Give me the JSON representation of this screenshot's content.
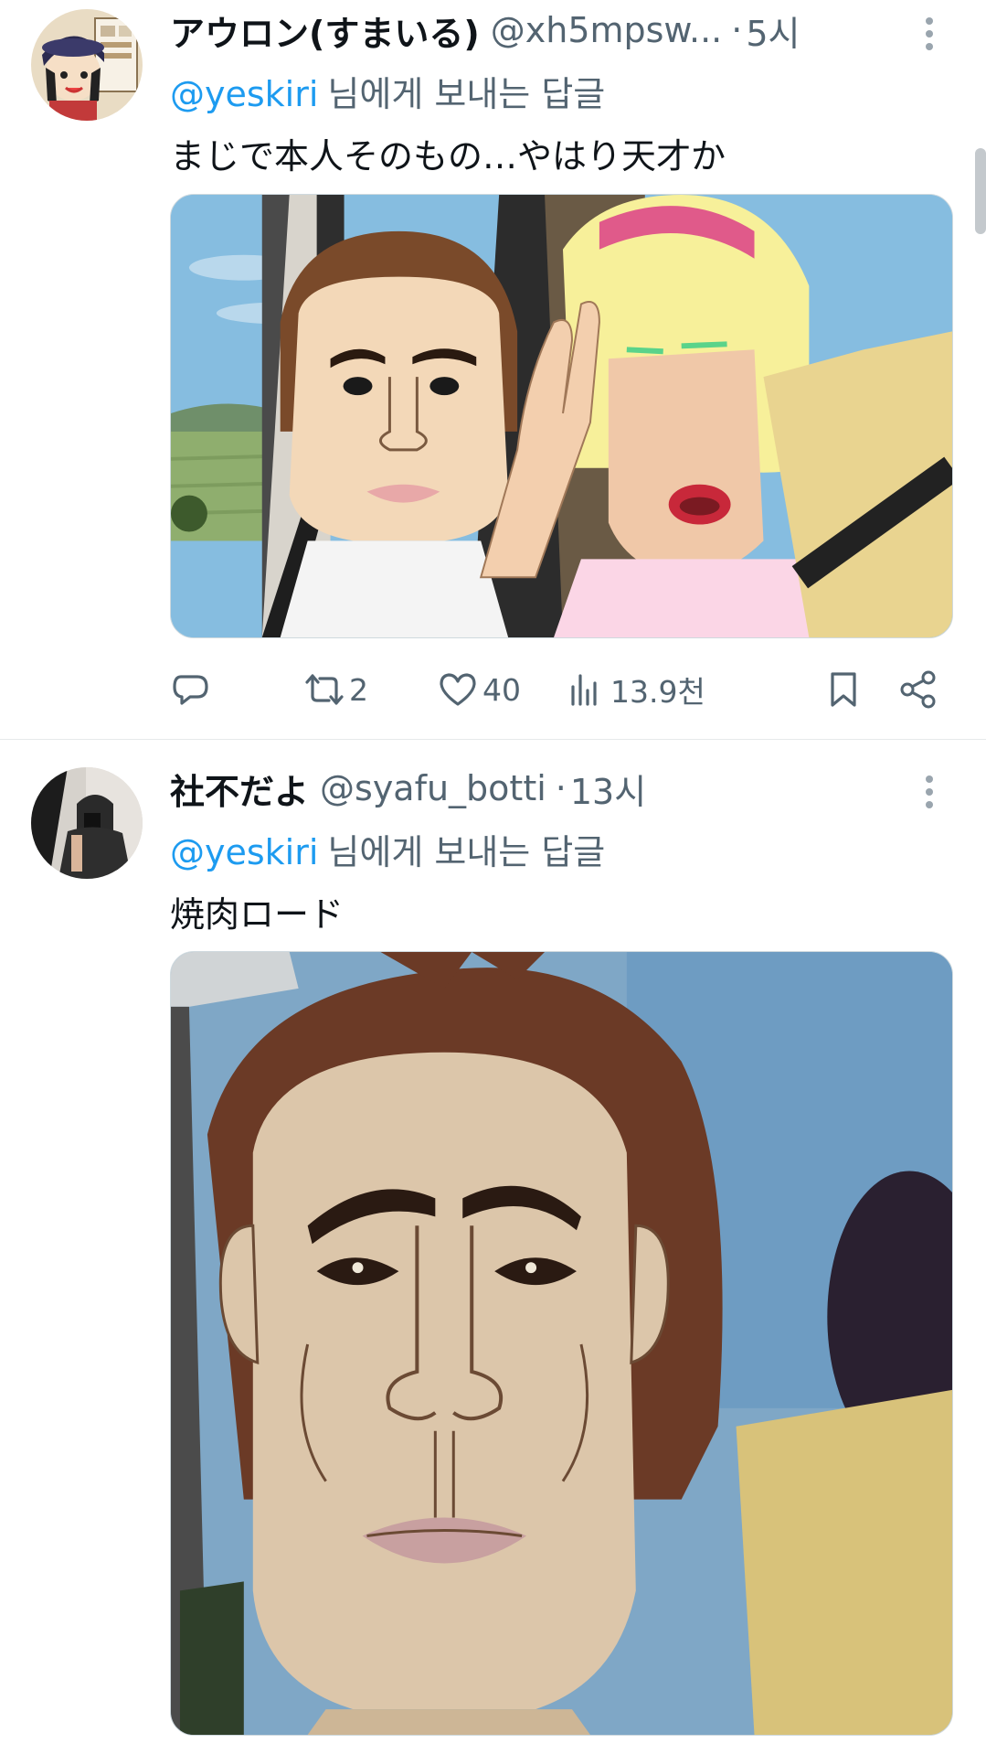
{
  "tweets": [
    {
      "display_name": "アウロン(すまいる)",
      "handle": "@xh5mpsw...",
      "separator": "·",
      "time": "5시",
      "reply_to_mention": "@yeskiri",
      "reply_to_suffix": "님에게 보내는 답글",
      "text": "まじで本人そのもの…やはり天才か",
      "media_description": "anime-screenshot-two-characters",
      "actions": {
        "reply_count": "",
        "retweet_count": "2",
        "like_count": "40",
        "views_count": "13.9천"
      }
    },
    {
      "display_name": "社不だよ",
      "handle": "@syafu_botti",
      "separator": "·",
      "time": "13시",
      "reply_to_mention": "@yeskiri",
      "reply_to_suffix": "님에게 보내는 답글",
      "text": "焼肉ロード",
      "media_description": "anime-screenshot-closeup-face"
    }
  ],
  "icons": {
    "more": "more-vertical-icon",
    "reply": "reply-icon",
    "retweet": "retweet-icon",
    "like": "heart-icon",
    "views": "views-chart-icon",
    "bookmark": "bookmark-icon",
    "share": "share-icon"
  },
  "colors": {
    "accent": "#1d9bf0",
    "secondary_text": "#536471",
    "primary_text": "#0f1419"
  }
}
